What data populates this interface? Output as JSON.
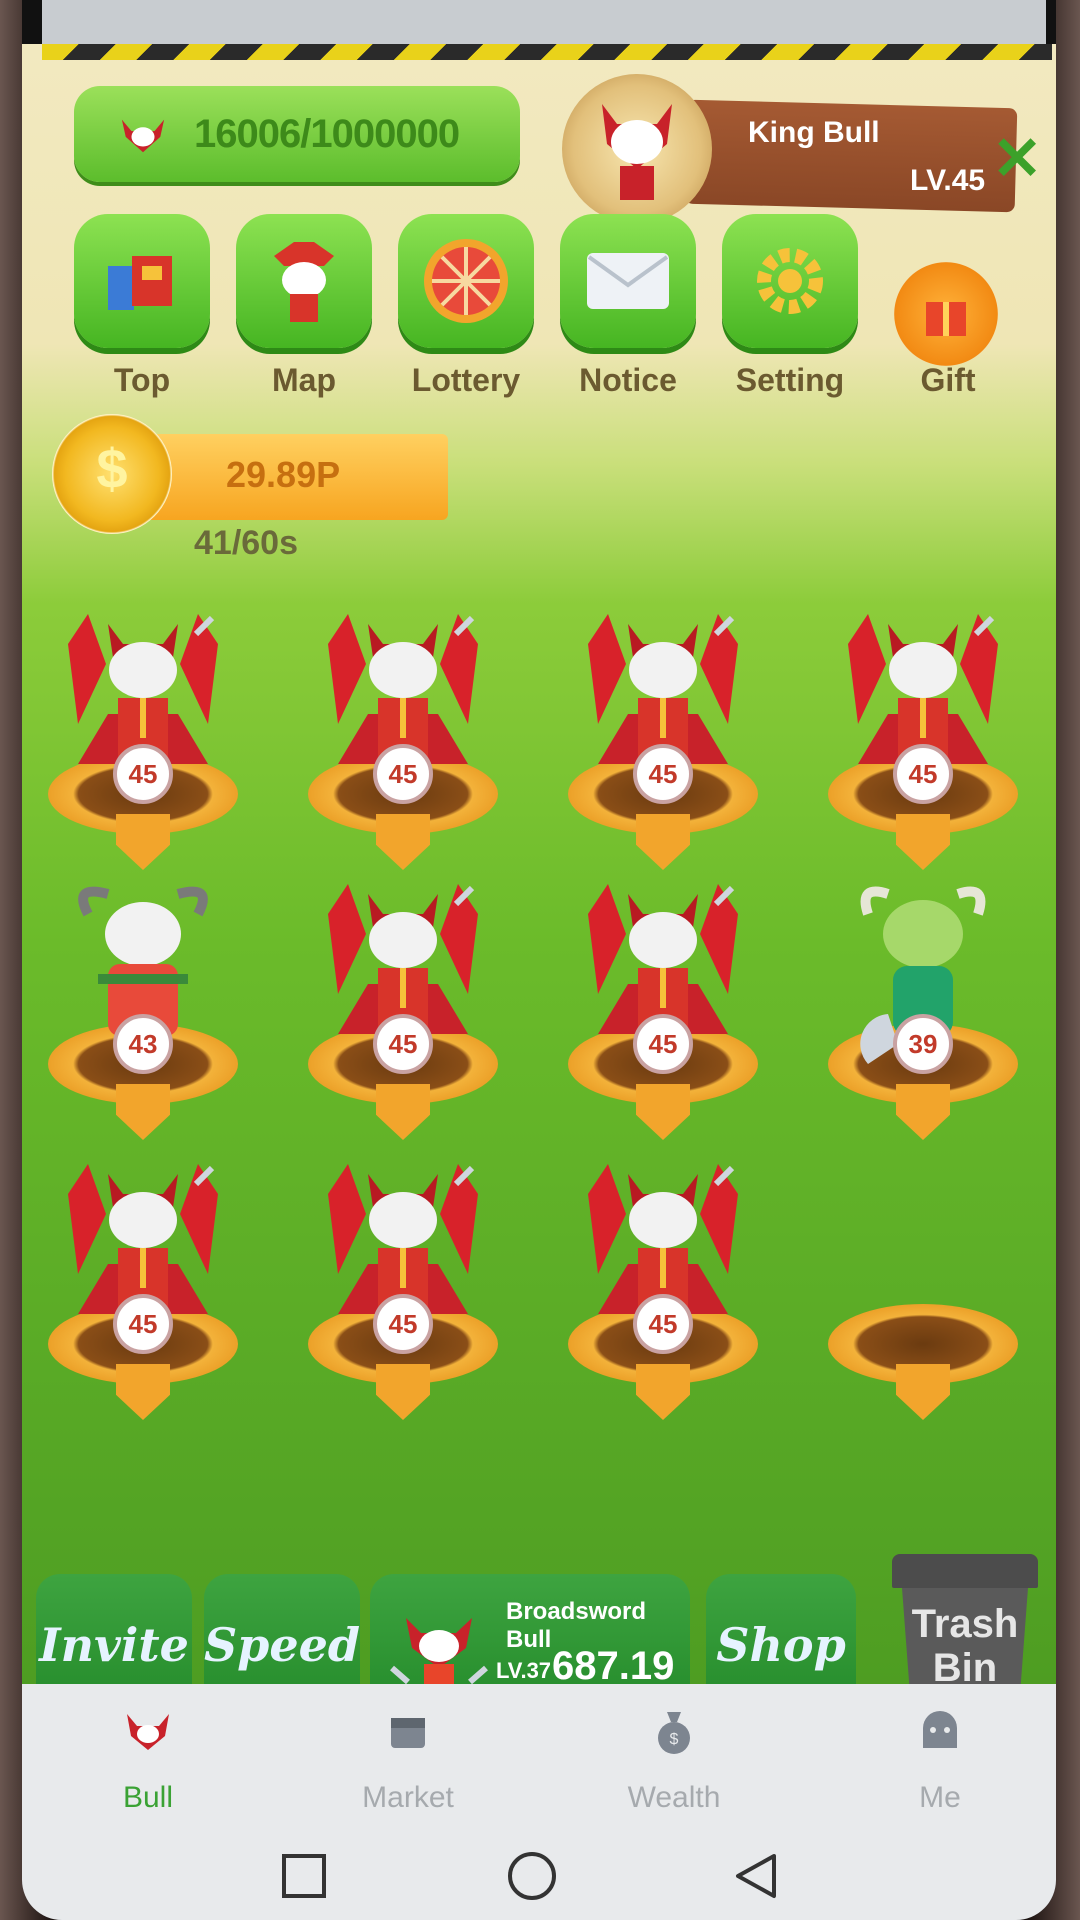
{
  "progress": {
    "value": "16006/1000000"
  },
  "king": {
    "name": "King Bull",
    "level": "LV.45"
  },
  "menu": [
    {
      "label": "Top",
      "icon": "top-icon"
    },
    {
      "label": "Map",
      "icon": "map-icon"
    },
    {
      "label": "Lottery",
      "icon": "lottery-wheel-icon"
    },
    {
      "label": "Notice",
      "icon": "envelope-icon"
    },
    {
      "label": "Setting",
      "icon": "gear-icon"
    },
    {
      "label": "Gift",
      "icon": "gift-icon"
    }
  ],
  "coin": {
    "amount": "29.89P",
    "timer": "41/60s",
    "symbol": "$"
  },
  "grid": {
    "slots": [
      {
        "level": "45"
      },
      {
        "level": "45"
      },
      {
        "level": "45"
      },
      {
        "level": "45"
      },
      {
        "level": "43"
      },
      {
        "level": "45"
      },
      {
        "level": "45"
      },
      {
        "level": "39"
      },
      {
        "level": "45"
      },
      {
        "level": "45"
      },
      {
        "level": "45"
      },
      {
        "level": ""
      }
    ]
  },
  "actions": {
    "invite": "Invite",
    "speed": "Speed",
    "shop": "Shop",
    "trash_line1": "Trash",
    "trash_line2": "Bin",
    "buy": {
      "name": "Broadsword Bull",
      "level": "LV.37",
      "price": "687.19"
    }
  },
  "nav": [
    {
      "label": "Bull",
      "active": true
    },
    {
      "label": "Market",
      "active": false
    },
    {
      "label": "Wealth",
      "active": false
    },
    {
      "label": "Me",
      "active": false
    }
  ],
  "colors": {
    "accent_green": "#3aa234",
    "gold": "#f2a52c",
    "bull_red": "#c8222a"
  }
}
